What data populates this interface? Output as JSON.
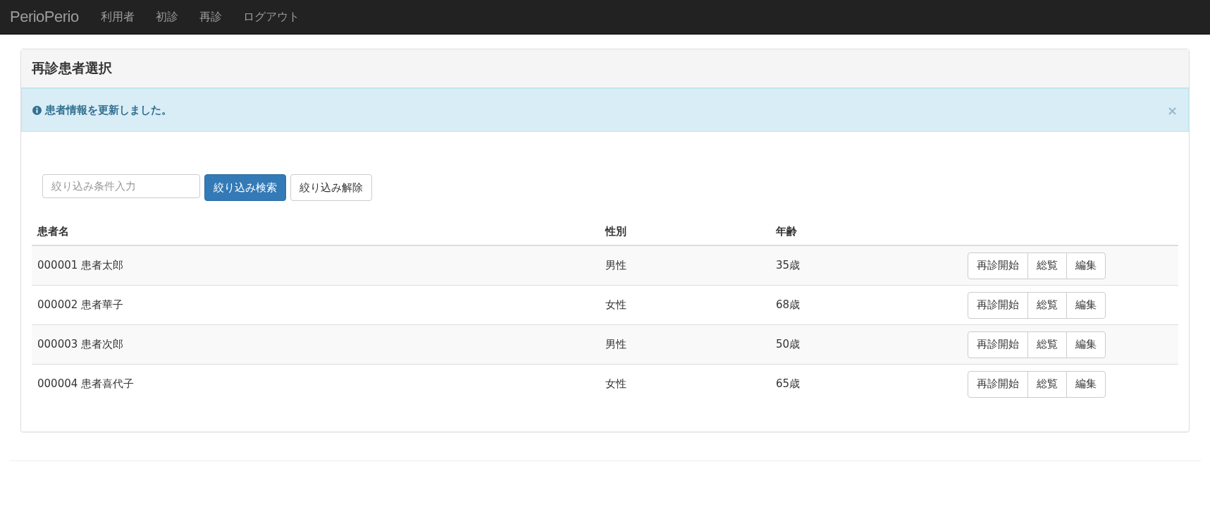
{
  "navbar": {
    "brand": "PerioPerio",
    "items": [
      "利用者",
      "初診",
      "再診",
      "ログアウト"
    ]
  },
  "panel": {
    "title": "再診患者選択",
    "alert": {
      "message": "患者情報を更新しました。",
      "close": "×"
    },
    "filter": {
      "placeholder": "絞り込み条件入力",
      "search_button": "絞り込み検索",
      "clear_button": "絞り込み解除"
    },
    "table": {
      "columns": [
        "患者名",
        "性別",
        "年齢"
      ],
      "rows": [
        {
          "name": "000001 患者太郎",
          "gender": "男性",
          "age": "35歳",
          "actions": [
            "再診開始",
            "総覧",
            "編集"
          ]
        },
        {
          "name": "000002 患者華子",
          "gender": "女性",
          "age": "68歳",
          "actions": [
            "再診開始",
            "総覧",
            "編集"
          ]
        },
        {
          "name": "000003 患者次郎",
          "gender": "男性",
          "age": "50歳",
          "actions": [
            "再診開始",
            "総覧",
            "編集"
          ]
        },
        {
          "name": "000004 患者喜代子",
          "gender": "女性",
          "age": "65歳",
          "actions": [
            "再診開始",
            "総覧",
            "編集"
          ]
        }
      ]
    }
  }
}
